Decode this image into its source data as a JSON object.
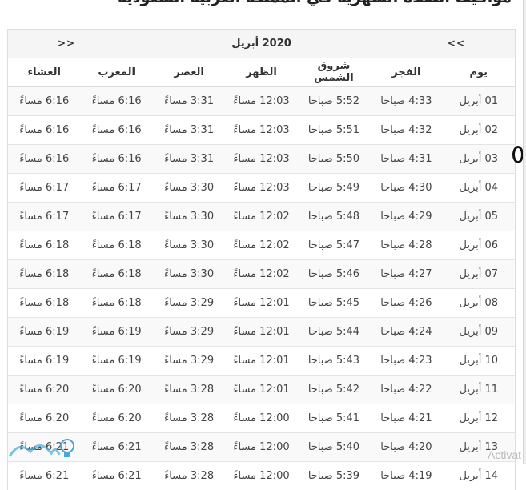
{
  "page": {
    "title": "مواقيت الصلاة الشهرية  في المملكة العربية السعودية"
  },
  "nav": {
    "month_label": "2020 أبريل",
    "prev_label": "<<",
    "next_label": ">>"
  },
  "table": {
    "headers": [
      "يوم",
      "الفجر",
      "شروق الشمس",
      "الظهر",
      "العصر",
      "المغرب",
      "العشاء"
    ],
    "rows": [
      [
        "01 أبريل",
        "4:33 صباحا",
        "5:52 صباحا",
        "12:03 مساءً",
        "3:31 مساءً",
        "6:16 مساءً",
        "6:16 مساءً"
      ],
      [
        "02 أبريل",
        "4:32 صباحا",
        "5:51 صباحا",
        "12:03 مساءً",
        "3:31 مساءً",
        "6:16 مساءً",
        "6:16 مساءً"
      ],
      [
        "03 أبريل",
        "4:31 صباحا",
        "5:50 صباحا",
        "12:03 مساءً",
        "3:31 مساءً",
        "6:16 مساءً",
        "6:16 مساءً"
      ],
      [
        "04 أبريل",
        "4:30 صباحا",
        "5:49 صباحا",
        "12:03 مساءً",
        "3:30 مساءً",
        "6:17 مساءً",
        "6:17 مساءً"
      ],
      [
        "05 أبريل",
        "4:29 صباحا",
        "5:48 صباحا",
        "12:02 مساءً",
        "3:30 مساءً",
        "6:17 مساءً",
        "6:17 مساءً"
      ],
      [
        "06 أبريل",
        "4:28 صباحا",
        "5:47 صباحا",
        "12:02 مساءً",
        "3:30 مساءً",
        "6:18 مساءً",
        "6:18 مساءً"
      ],
      [
        "07 أبريل",
        "4:27 صباحا",
        "5:46 صباحا",
        "12:02 مساءً",
        "3:30 مساءً",
        "6:18 مساءً",
        "6:18 مساءً"
      ],
      [
        "08 أبريل",
        "4:26 صباحا",
        "5:45 صباحا",
        "12:01 مساءً",
        "3:29 مساءً",
        "6:18 مساءً",
        "6:18 مساءً"
      ],
      [
        "09 أبريل",
        "4:24 صباحا",
        "5:44 صباحا",
        "12:01 مساءً",
        "3:29 مساءً",
        "6:19 مساءً",
        "6:19 مساءً"
      ],
      [
        "10 أبريل",
        "4:23 صباحا",
        "5:43 صباحا",
        "12:01 مساءً",
        "3:29 مساءً",
        "6:19 مساءً",
        "6:19 مساءً"
      ],
      [
        "11 أبريل",
        "4:22 صباحا",
        "5:42 صباحا",
        "12:01 مساءً",
        "3:28 مساءً",
        "6:20 مساءً",
        "6:20 مساءً"
      ],
      [
        "12 أبريل",
        "4:21 صباحا",
        "5:41 صباحا",
        "12:00 مساءً",
        "3:28 مساءً",
        "6:20 مساءً",
        "6:20 مساءً"
      ],
      [
        "13 أبريل",
        "4:20 صباحا",
        "5:40 صباحا",
        "12:00 مساءً",
        "3:28 مساءً",
        "6:21 مساءً",
        "6:21 مساءً"
      ],
      [
        "14 أبريل",
        "4:19 صباحا",
        "5:39 صباحا",
        "12:00 مساءً",
        "3:28 مساءً",
        "6:21 مساءً",
        "6:21 مساءً"
      ]
    ]
  },
  "overlay": {
    "watermark": "Activat",
    "logo_icon": "lightbulb-logo-icon"
  },
  "colors": {
    "header_bg": "#f5f5f5",
    "stripe_bg": "#f9f9f9",
    "border": "#dddddd",
    "logo": "#4aa8d8"
  }
}
